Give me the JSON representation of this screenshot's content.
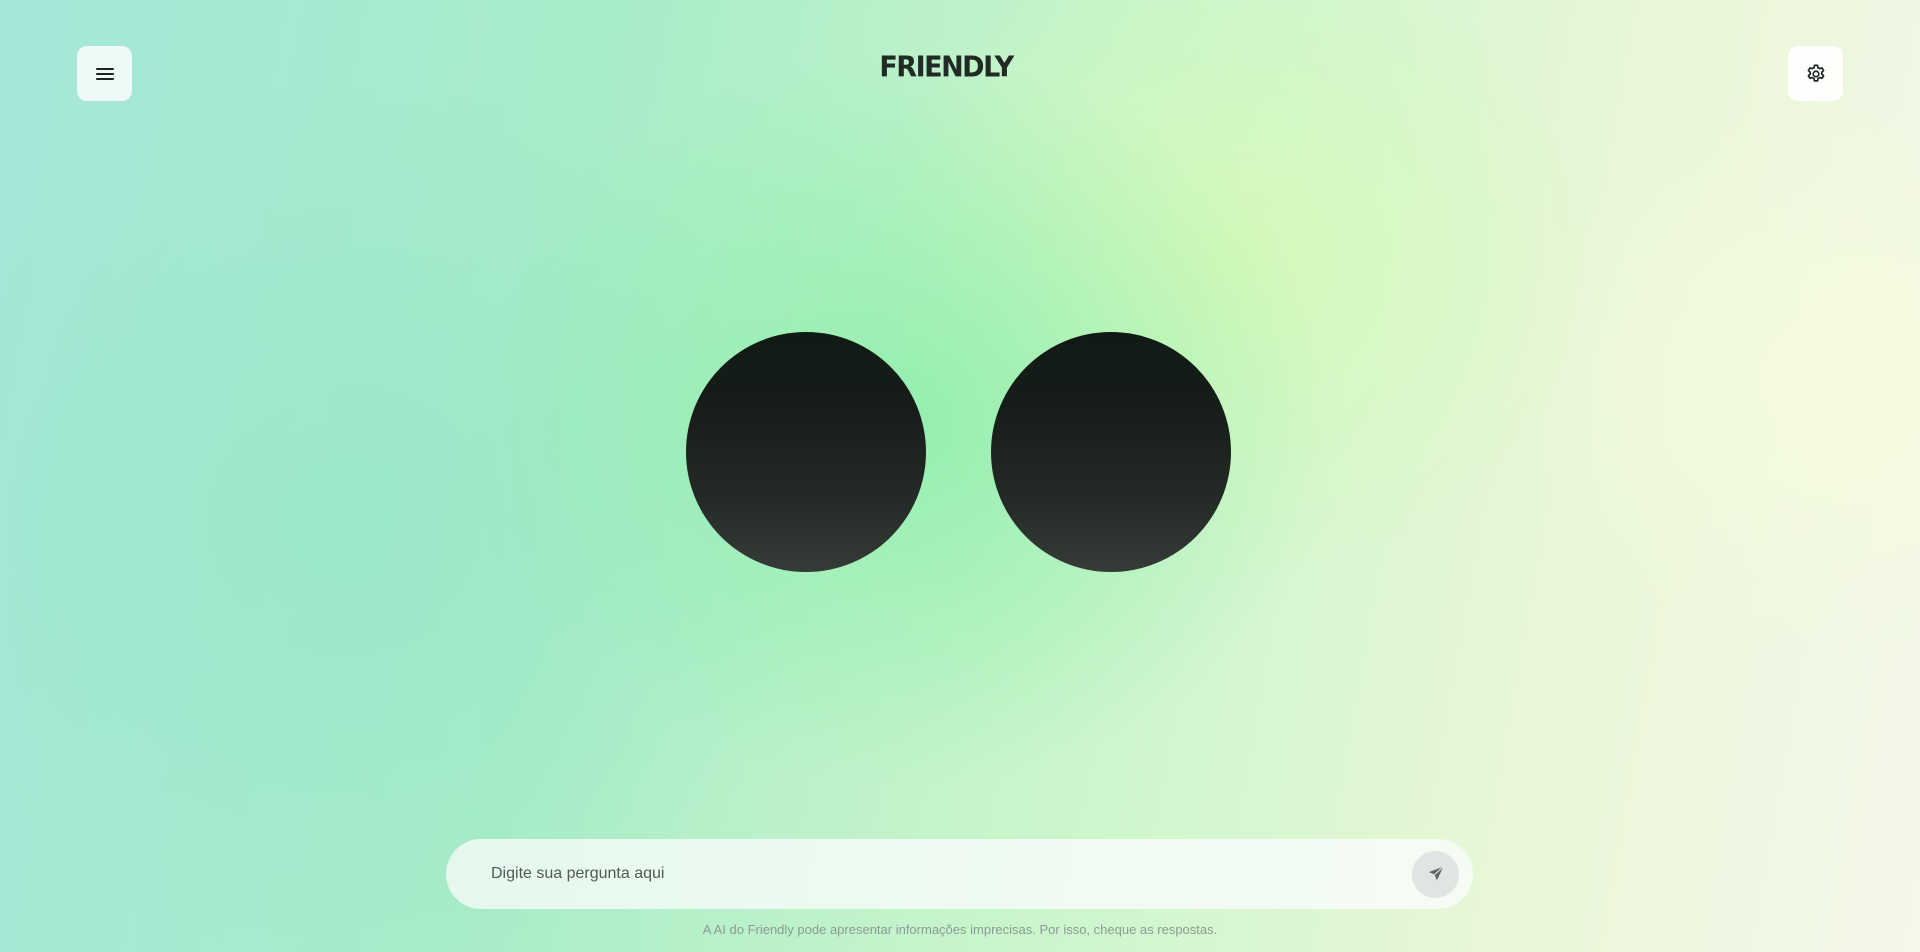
{
  "header": {
    "brand": "FRIENDLY",
    "menu_icon": "hamburger-menu-icon",
    "settings_icon": "gear-icon"
  },
  "mascot": {
    "eyes": [
      "left-eye",
      "right-eye"
    ]
  },
  "chat": {
    "placeholder": "Digite sua pergunta aqui",
    "value": "",
    "send_icon": "send-icon"
  },
  "footer": {
    "disclaimer": "A AI do Friendly pode apresentar informações imprecisas. Por isso, cheque as respostas."
  },
  "colors": {
    "text_dark": "#222a26",
    "eye_top": "#111a15",
    "eye_bottom": "#353b37"
  }
}
